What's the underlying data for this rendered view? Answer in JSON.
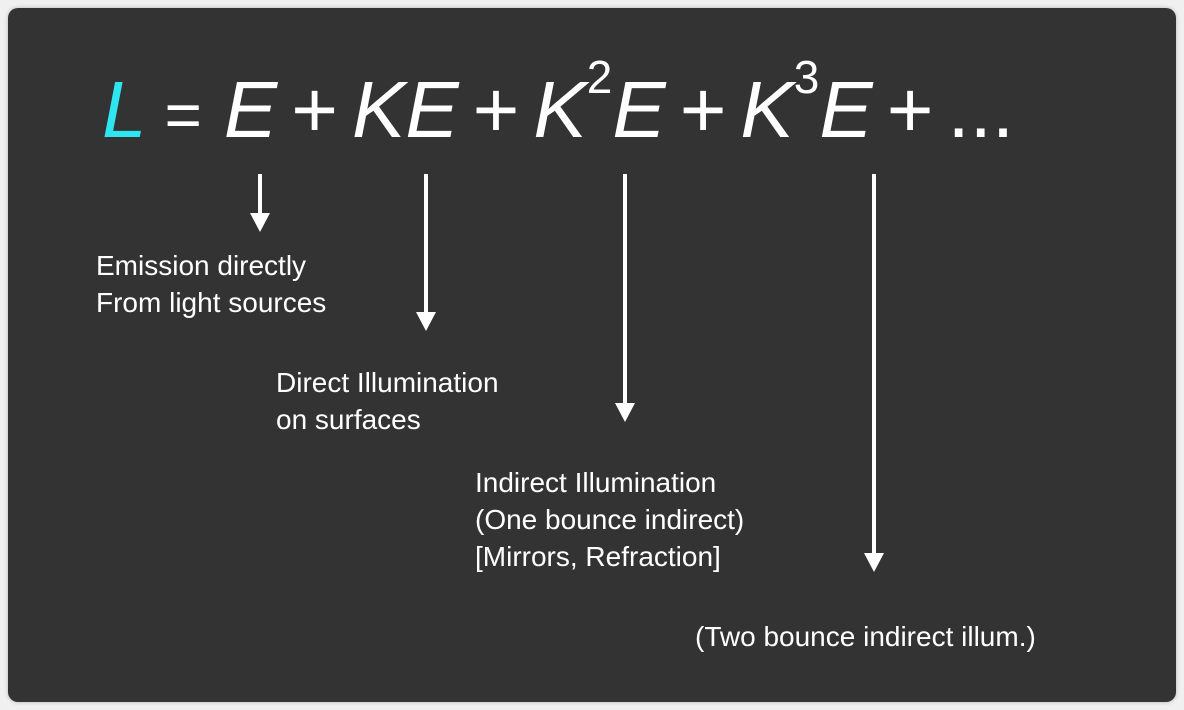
{
  "equation": {
    "lhs": "L",
    "equals": "=",
    "terms": [
      {
        "base": "E",
        "power": ""
      },
      {
        "base": "KE",
        "power": ""
      },
      {
        "base": "K",
        "power": "2",
        "tail": "E"
      },
      {
        "base": "K",
        "power": "3",
        "tail": "E"
      }
    ],
    "plus": "+",
    "ellipsis": "...",
    "lhs_color": "#2ee6f0",
    "text_color": "#ffffff"
  },
  "labels": {
    "emission": {
      "line1": "Emission directly",
      "line2": "From light sources"
    },
    "direct": {
      "line1": "Direct Illumination",
      "line2": "on surfaces"
    },
    "indirect": {
      "line1": "Indirect Illumination",
      "line2": "(One bounce indirect)",
      "line3": "[Mirrors, Refraction]"
    },
    "two_bounce": {
      "line1": "(Two bounce indirect illum.)"
    }
  },
  "colors": {
    "background": "#333333",
    "page": "#f0f0f0",
    "arrow": "#ffffff"
  }
}
